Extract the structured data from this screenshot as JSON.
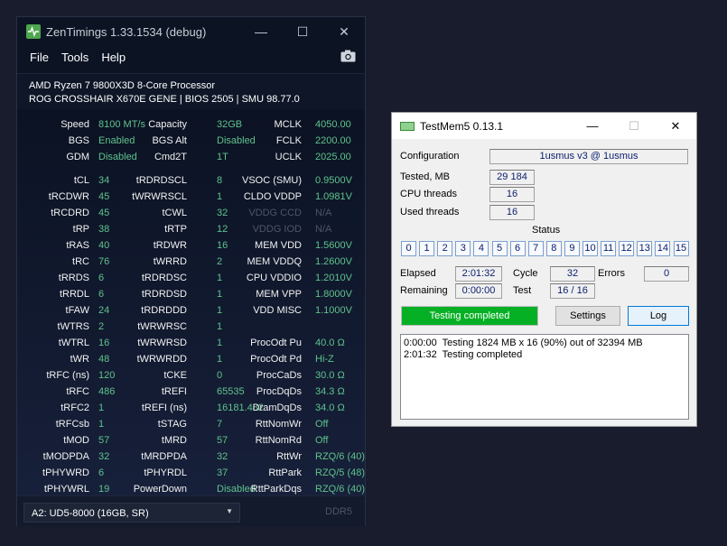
{
  "zentimings": {
    "title": "ZenTimings 1.33.1534 (debug)",
    "window_buttons": {
      "minimize": "—",
      "maximize": "☐",
      "close": "✕"
    },
    "menu": [
      "File",
      "Tools",
      "Help"
    ],
    "cpu": "AMD Ryzen 7 9800X3D 8-Core Processor",
    "board": "ROG CROSSHAIR X670E GENE | BIOS 2505 | SMU 98.77.0",
    "rows": [
      [
        {
          "l": "Speed",
          "v": "8100 MT/s"
        },
        {
          "l": "Capacity",
          "v": "32GB"
        },
        {
          "l": "MCLK",
          "v": "4050.00"
        }
      ],
      [
        {
          "l": "BGS",
          "v": "Enabled"
        },
        {
          "l": "BGS Alt",
          "v": "Disabled"
        },
        {
          "l": "FCLK",
          "v": "2200.00"
        }
      ],
      [
        {
          "l": "GDM",
          "v": "Disabled"
        },
        {
          "l": "Cmd2T",
          "v": "1T"
        },
        {
          "l": "UCLK",
          "v": "2025.00"
        }
      ],
      null,
      [
        {
          "l": "tCL",
          "v": "34"
        },
        {
          "l": "tRDRDSCL",
          "v": "8"
        },
        {
          "l": "VSOC (SMU)",
          "v": "0.9500V"
        }
      ],
      [
        {
          "l": "tRCDWR",
          "v": "45"
        },
        {
          "l": "tWRWRSCL",
          "v": "1"
        },
        {
          "l": "CLDO VDDP",
          "v": "1.0981V"
        }
      ],
      [
        {
          "l": "tRCDRD",
          "v": "45"
        },
        {
          "l": "tCWL",
          "v": "32"
        },
        {
          "l": "VDDG CCD",
          "v": "N/A",
          "dim": true
        }
      ],
      [
        {
          "l": "tRP",
          "v": "38"
        },
        {
          "l": "tRTP",
          "v": "12"
        },
        {
          "l": "VDDG IOD",
          "v": "N/A",
          "dim": true
        }
      ],
      [
        {
          "l": "tRAS",
          "v": "40"
        },
        {
          "l": "tRDWR",
          "v": "16"
        },
        {
          "l": "MEM VDD",
          "v": "1.5600V"
        }
      ],
      [
        {
          "l": "tRC",
          "v": "76"
        },
        {
          "l": "tWRRD",
          "v": "2"
        },
        {
          "l": "MEM VDDQ",
          "v": "1.2600V"
        }
      ],
      [
        {
          "l": "tRRDS",
          "v": "6"
        },
        {
          "l": "tRDRDSC",
          "v": "1"
        },
        {
          "l": "CPU VDDIO",
          "v": "1.2010V"
        }
      ],
      [
        {
          "l": "tRRDL",
          "v": "6"
        },
        {
          "l": "tRDRDSD",
          "v": "1"
        },
        {
          "l": "MEM VPP",
          "v": "1.8000V"
        }
      ],
      [
        {
          "l": "tFAW",
          "v": "24"
        },
        {
          "l": "tRDRDDD",
          "v": "1"
        },
        {
          "l": "VDD MISC",
          "v": "1.1000V"
        }
      ],
      [
        {
          "l": "tWTRS",
          "v": "2"
        },
        {
          "l": "tWRWRSC",
          "v": "1"
        },
        null
      ],
      [
        {
          "l": "tWTRL",
          "v": "16"
        },
        {
          "l": "tWRWRSD",
          "v": "1"
        },
        {
          "l": "ProcOdt Pu",
          "v": "40.0 Ω"
        }
      ],
      [
        {
          "l": "tWR",
          "v": "48"
        },
        {
          "l": "tWRWRDD",
          "v": "1"
        },
        {
          "l": "ProcOdt Pd",
          "v": "Hi-Z"
        }
      ],
      [
        {
          "l": "tRFC (ns)",
          "v": "120"
        },
        {
          "l": "tCKE",
          "v": "0"
        },
        {
          "l": "ProcCaDs",
          "v": "30.0 Ω"
        }
      ],
      [
        {
          "l": "tRFC",
          "v": "486"
        },
        {
          "l": "tREFI",
          "v": "65535"
        },
        {
          "l": "ProcDqDs",
          "v": "34.3 Ω"
        }
      ],
      [
        {
          "l": "tRFC2",
          "v": "1"
        },
        {
          "l": "tREFI (ns)",
          "v": "16181.482"
        },
        {
          "l": "DramDqDs",
          "v": "34.0 Ω"
        }
      ],
      [
        {
          "l": "tRFCsb",
          "v": "1"
        },
        {
          "l": "tSTAG",
          "v": "7"
        },
        {
          "l": "RttNomWr",
          "v": "Off"
        }
      ],
      [
        {
          "l": "tMOD",
          "v": "57"
        },
        {
          "l": "tMRD",
          "v": "57"
        },
        {
          "l": "RttNomRd",
          "v": "Off"
        }
      ],
      [
        {
          "l": "tMODPDA",
          "v": "32"
        },
        {
          "l": "tMRDPDA",
          "v": "32"
        },
        {
          "l": "RttWr",
          "v": "RZQ/6 (40)"
        }
      ],
      [
        {
          "l": "tPHYWRD",
          "v": "6"
        },
        {
          "l": "tPHYRDL",
          "v": "37"
        },
        {
          "l": "RttPark",
          "v": "RZQ/5 (48)"
        }
      ],
      [
        {
          "l": "tPHYWRL",
          "v": "19"
        },
        {
          "l": "PowerDown",
          "v": "Disabled"
        },
        {
          "l": "RttParkDqs",
          "v": "RZQ/6 (40)"
        }
      ]
    ],
    "dimm_select": "A2: UD5-8000 (16GB, SR)",
    "memtype": "DDR5"
  },
  "testmem5": {
    "title": "TestMem5  0.13.1",
    "window_buttons": {
      "minimize": "—",
      "maximize": "☐",
      "close": "✕"
    },
    "config_label": "Configuration",
    "config_value": "1usmus v3 @ 1usmus",
    "tested_label": "Tested, MB",
    "tested_value": "29 184",
    "cpu_threads_label": "CPU threads",
    "cpu_threads_value": "16",
    "used_threads_label": "Used threads",
    "used_threads_value": "16",
    "status_label": "Status",
    "status_cells": [
      "0",
      "1",
      "2",
      "3",
      "4",
      "5",
      "6",
      "7",
      "8",
      "9",
      "10",
      "11",
      "12",
      "13",
      "14",
      "15"
    ],
    "elapsed_label": "Elapsed",
    "elapsed_value": "2:01:32",
    "cycle_label": "Cycle",
    "cycle_value": "32",
    "errors_label": "Errors",
    "errors_value": "0",
    "remaining_label": "Remaining",
    "remaining_value": "0:00:00",
    "test_label": "Test",
    "test_value": "16 / 16",
    "progress_text": "Testing completed",
    "settings_button": "Settings",
    "log_button": "Log",
    "log_lines": [
      "0:00:00  Testing 1824 MB x 16 (90%) out of 32394 MB",
      "2:01:32  Testing completed"
    ]
  }
}
